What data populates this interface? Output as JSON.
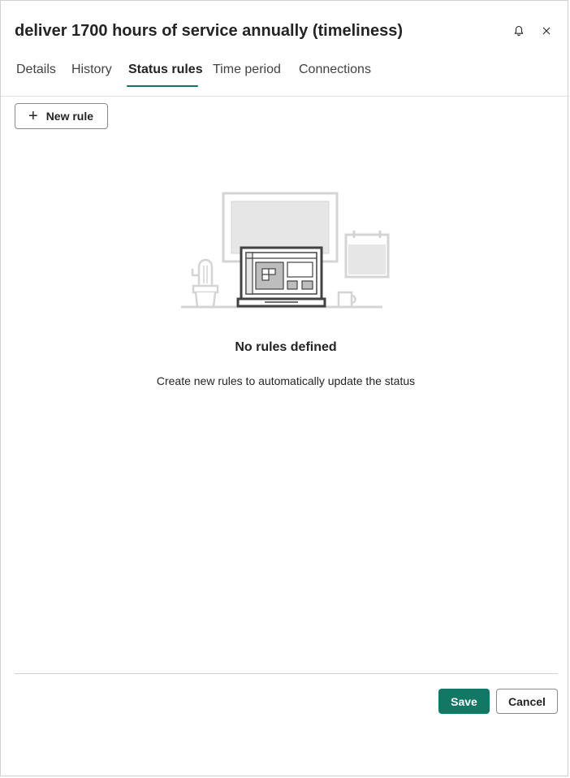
{
  "header": {
    "title": "deliver 1700 hours of service annually (timeliness)",
    "icons": [
      "bell-icon",
      "close-icon"
    ]
  },
  "tabs": [
    {
      "label": "Details",
      "active": false
    },
    {
      "label": "History",
      "active": false
    },
    {
      "label": "Status rules",
      "active": true
    },
    {
      "label": "Time period",
      "active": false
    },
    {
      "label": "Connections",
      "active": false
    }
  ],
  "toolbar": {
    "new_rule_label": "New rule",
    "new_rule_icon": "plus-icon"
  },
  "empty_state": {
    "illustration": "desk-laptop-illustration",
    "title": "No rules defined",
    "subtitle": "Create new rules to automatically update the status"
  },
  "footer": {
    "save_label": "Save",
    "cancel_label": "Cancel"
  },
  "colors": {
    "accent": "#117865",
    "text": "#242424",
    "divider": "#e0e0e0"
  }
}
